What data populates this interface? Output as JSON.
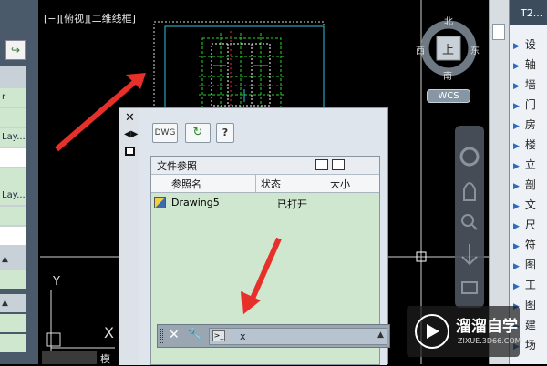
{
  "viewport": {
    "label": "[−][俯视][二维线框]",
    "model_tab": "模"
  },
  "left_palette": {
    "labels": [
      "r",
      "Lay...",
      "Lay..."
    ]
  },
  "viewcube": {
    "north": "北",
    "south": "南",
    "east": "东",
    "west": "西",
    "face": "上",
    "wcs": "WCS"
  },
  "tool_palette": {
    "title": "T2...",
    "items": [
      "设",
      "轴",
      "墙",
      "门",
      "房",
      "楼",
      "立",
      "剖",
      "文",
      "尺",
      "符",
      "图",
      "工",
      "图",
      "建",
      "场"
    ]
  },
  "xref_palette": {
    "section_title": "文件参照",
    "columns": [
      "参照名",
      "状态",
      "大小"
    ],
    "rows": [
      {
        "name": "Drawing5",
        "status": "已打开"
      }
    ],
    "toolbar": {
      "attach": "DWG",
      "help": "?"
    }
  },
  "command_line": {
    "prompt": "x"
  },
  "ucs": {
    "y": "Y",
    "x": "X"
  },
  "watermark": {
    "title": "溜溜自学",
    "url": "ZIXUE.3D66.COM"
  },
  "colors": {
    "arrow": "#e8302a",
    "palette_green": "#cfe7cf",
    "canvas": "#000000"
  }
}
